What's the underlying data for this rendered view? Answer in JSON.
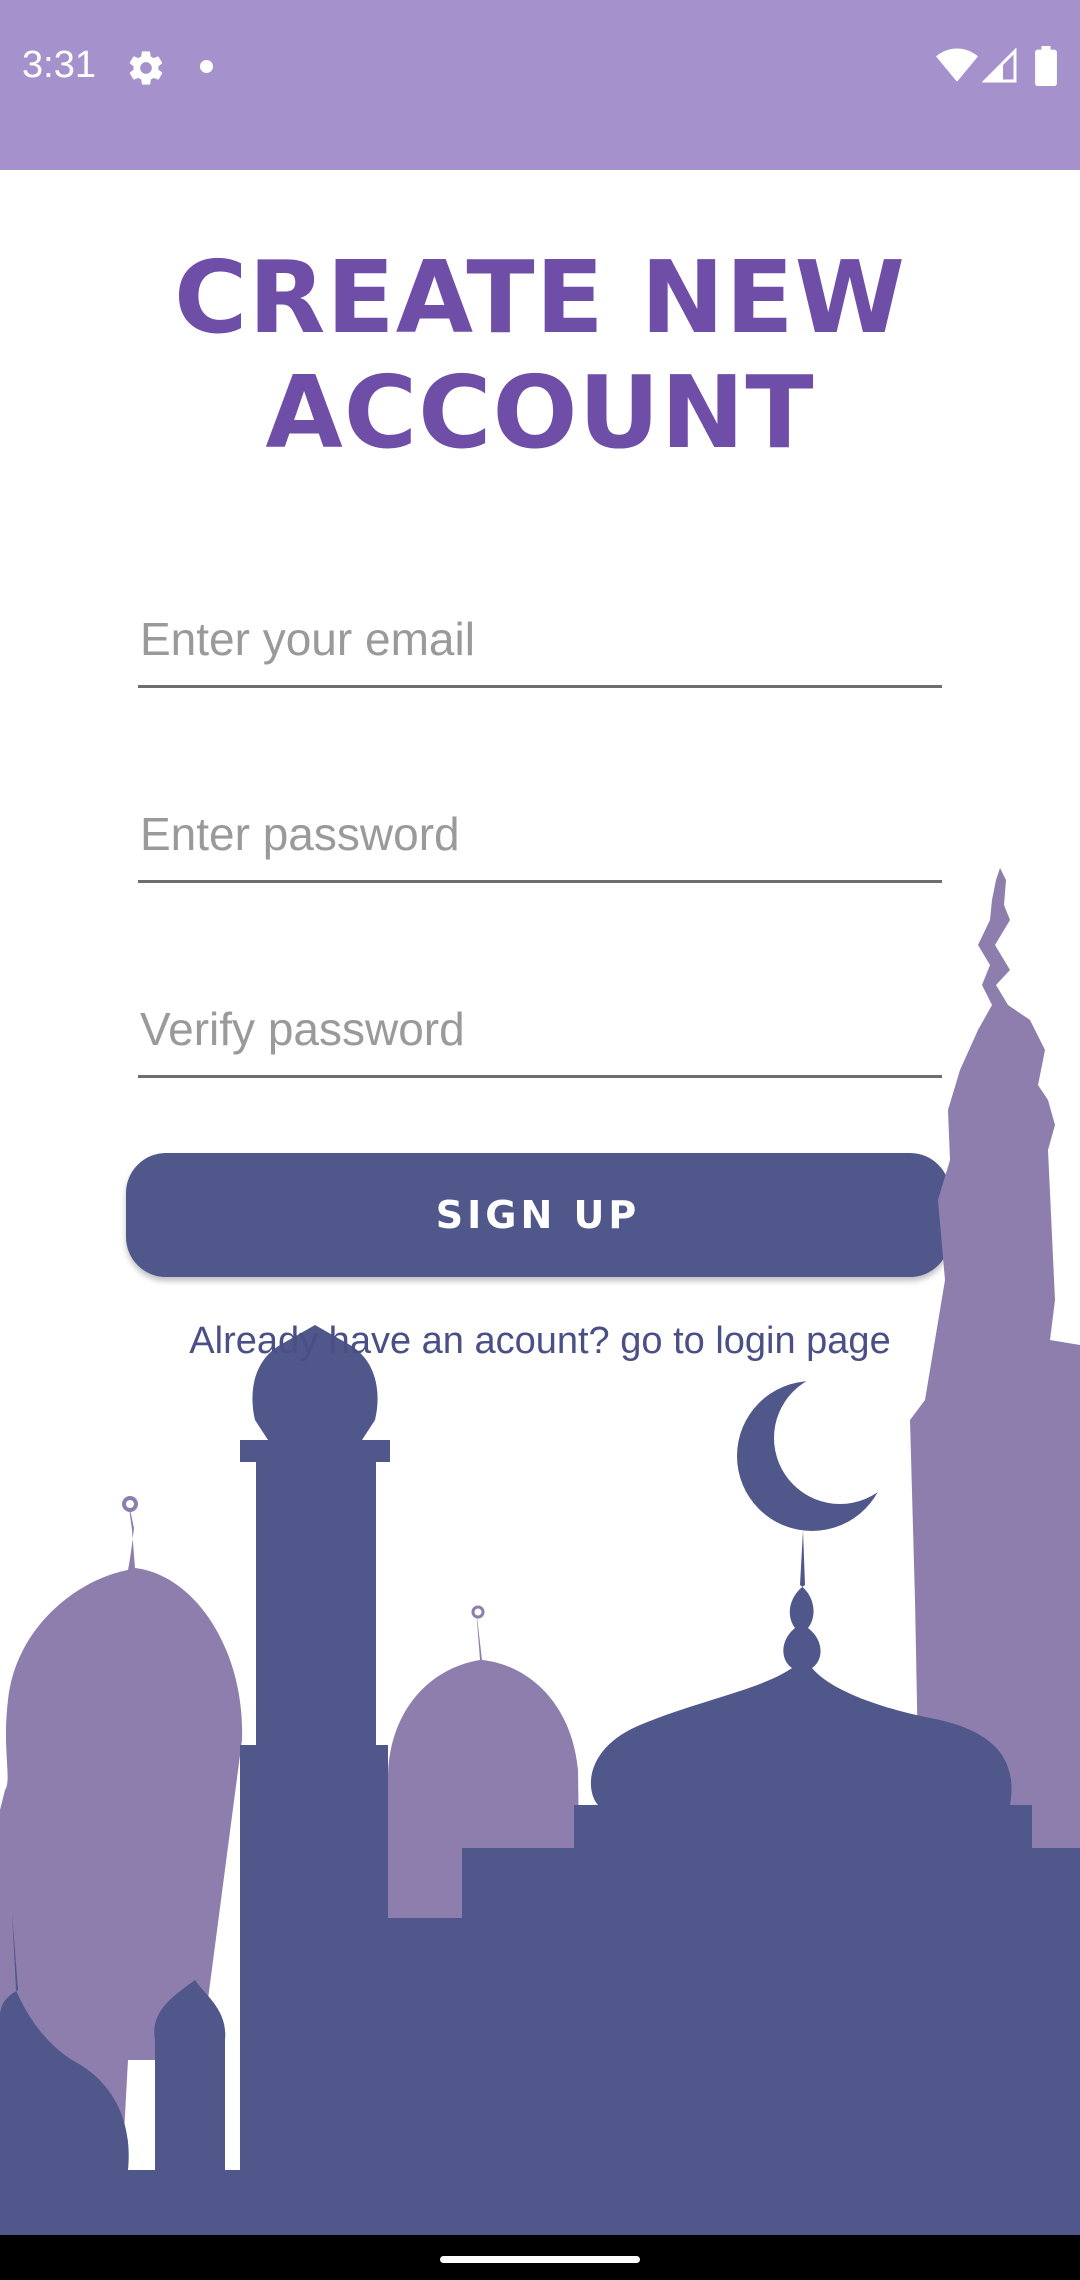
{
  "status_bar": {
    "time": "3:31",
    "icons": [
      "gear-icon",
      "notification-dot-icon",
      "wifi-icon",
      "signal-icon",
      "battery-icon"
    ],
    "background": "#a592cc"
  },
  "title": {
    "line1": "CREATE NEW",
    "line2": "ACCOUNT",
    "color": "#6f4ea8"
  },
  "form": {
    "email_placeholder": "Enter your email",
    "password_placeholder": "Enter password",
    "verify_placeholder": "Verify password",
    "signup_label": "SIGN UP",
    "login_link": "Already have an acount? go to login page"
  },
  "colors": {
    "accent_dark": "#50578a",
    "accent_light": "#8d7eae"
  },
  "illustration": "mosque-skyline"
}
